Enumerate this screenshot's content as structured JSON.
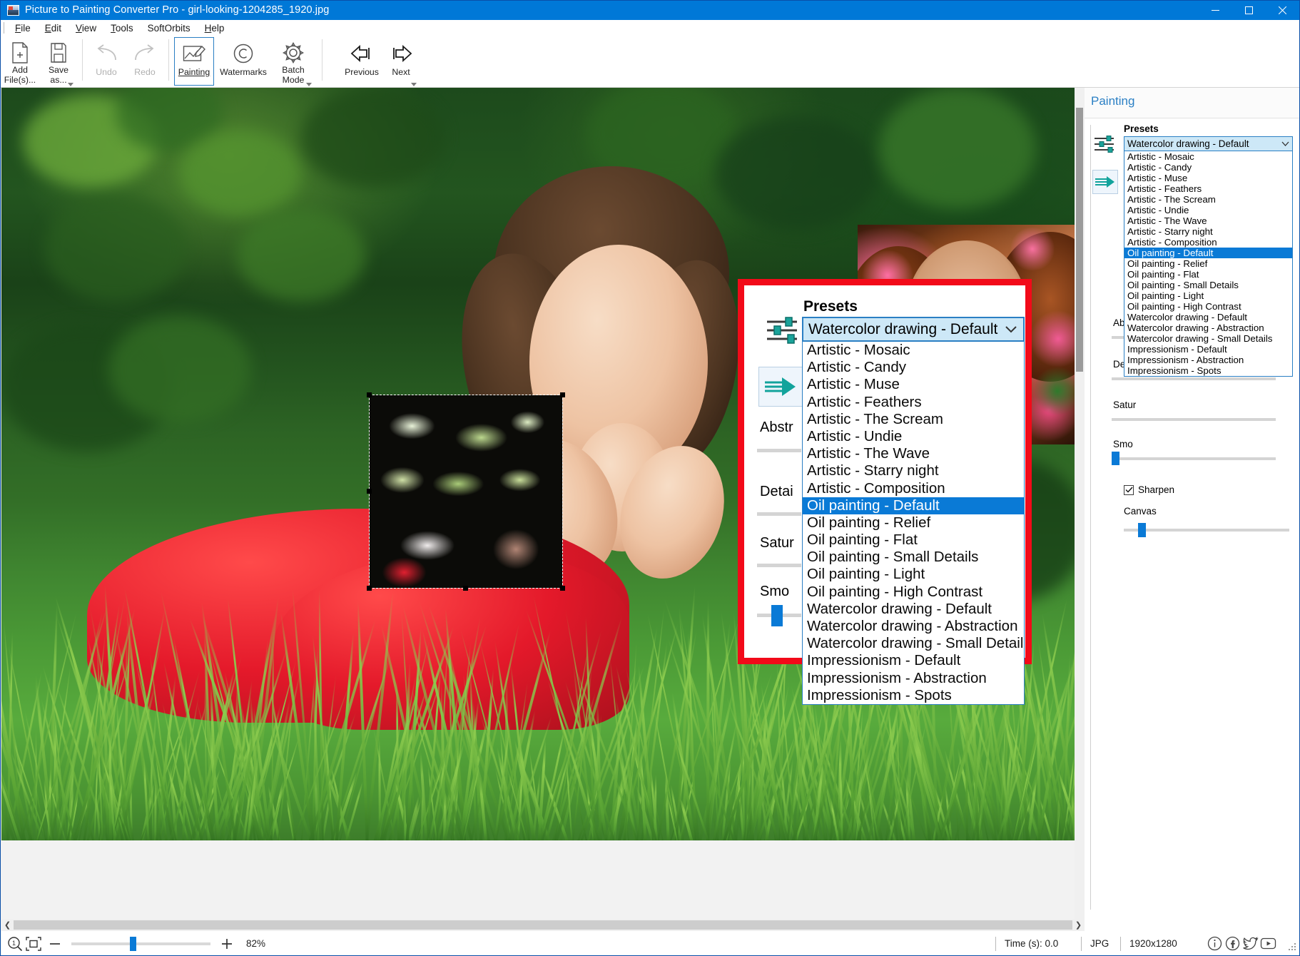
{
  "window": {
    "title": "Picture to Painting Converter Pro - girl-looking-1204285_1920.jpg",
    "minimize_label": "—",
    "maximize_label": "□",
    "close_label": "✕"
  },
  "menu": {
    "items": [
      {
        "label": "File"
      },
      {
        "label": "Edit"
      },
      {
        "label": "View"
      },
      {
        "label": "Tools"
      },
      {
        "label": "SoftOrbits"
      },
      {
        "label": "Help"
      }
    ]
  },
  "toolbar": {
    "add_files": "Add\nFile(s)...",
    "save_as": "Save\nas...",
    "undo": "Undo",
    "redo": "Redo",
    "painting": "Painting",
    "watermarks": "Watermarks",
    "batch_mode": "Batch\nMode",
    "previous": "Previous",
    "next": "Next"
  },
  "panel": {
    "title": "Painting",
    "presets_label": "Presets",
    "selected_preset": "Watercolor drawing - Default",
    "highlighted_preset": "Oil painting - Default",
    "preset_options": [
      "Artistic - Mosaic",
      "Artistic - Candy",
      "Artistic - Muse",
      "Artistic - Feathers",
      "Artistic - The Scream",
      "Artistic - Undie",
      "Artistic - The Wave",
      "Artistic - Starry night",
      "Artistic - Composition",
      "Oil painting - Default",
      "Oil painting - Relief",
      "Oil painting - Flat",
      "Oil painting - Small Details",
      "Oil painting - Light",
      "Oil painting - High Contrast",
      "Watercolor drawing - Default",
      "Watercolor drawing - Abstraction",
      "Watercolor drawing - Small Details",
      "Impressionism - Default",
      "Impressionism - Abstraction",
      "Impressionism - Spots"
    ],
    "sliders": [
      {
        "label": "Abstraction",
        "truncated": "Abstr"
      },
      {
        "label": "Details",
        "truncated": "Detai"
      },
      {
        "label": "Saturation",
        "truncated": "Satur"
      },
      {
        "label": "Smoothing",
        "truncated": "Smo"
      }
    ],
    "sharpen_label": "Sharpen",
    "sharpen_checked": true,
    "canvas_label": "Canvas"
  },
  "magnifier": {
    "presets_label": "Presets",
    "selected_preset": "Watercolor drawing - Default",
    "highlighted_preset": "Oil painting - Default",
    "border_color": "#f20a19"
  },
  "statusbar": {
    "zoom_percent": "82%",
    "zoom_out_label": "—",
    "zoom_in_label": "+",
    "time": "Time (s): 0.0",
    "format": "JPG",
    "dimensions": "1920x1280",
    "social": [
      "info-icon",
      "facebook-icon",
      "twitter-icon",
      "youtube-icon"
    ]
  },
  "colors": {
    "accent": "#0078d7",
    "panel_title": "#2a7fc4",
    "highlight": "#0a7ad6",
    "combo_bg": "#cde8f7",
    "magnifier_border": "#f20a19"
  }
}
